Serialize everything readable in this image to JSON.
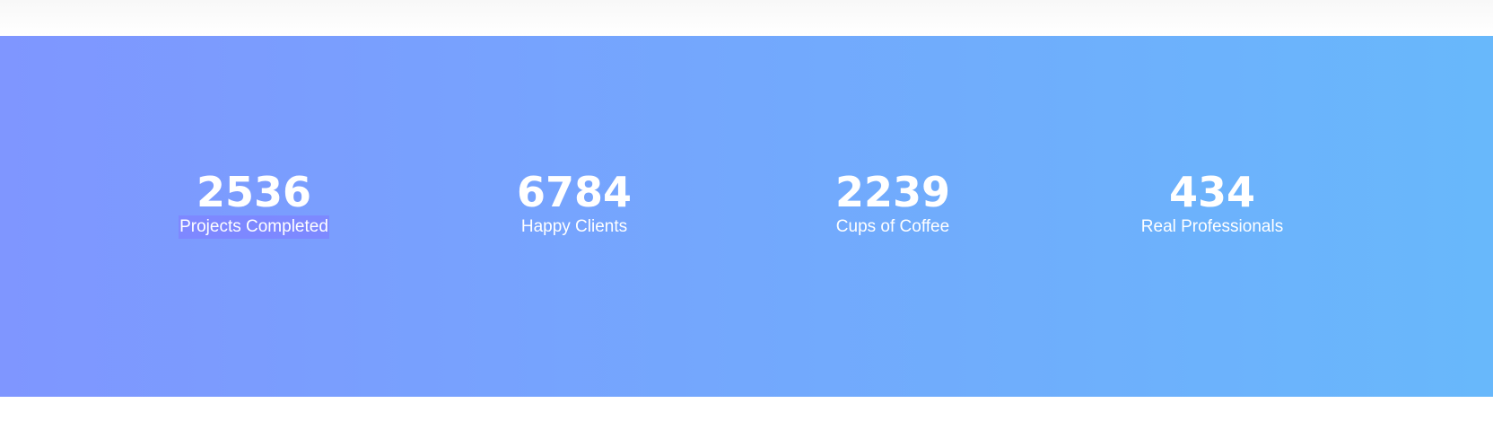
{
  "colors": {
    "band_gradient_start": "#7f96ff",
    "band_gradient_mid": "#73a8fd",
    "band_gradient_end": "#68b8fb",
    "text": "#ffffff",
    "selection_highlight": "#8078ff"
  },
  "stats": [
    {
      "number": "2536",
      "label": "Projects Completed"
    },
    {
      "number": "6784",
      "label": "Happy Clients"
    },
    {
      "number": "2239",
      "label": "Cups of Coffee"
    },
    {
      "number": "434",
      "label": "Real Professionals"
    }
  ]
}
